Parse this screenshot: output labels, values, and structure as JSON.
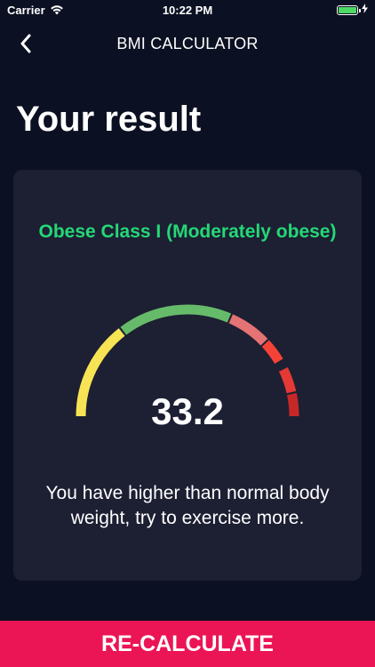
{
  "status_bar": {
    "carrier": "Carrier",
    "time": "10:22 PM",
    "icons": [
      "wifi-icon",
      "battery-icon",
      "charging-bolt-icon"
    ]
  },
  "nav": {
    "title": "BMI CALCULATOR",
    "back_icon": "chevron-left-icon"
  },
  "page_title": "Your result",
  "result": {
    "category": "Obese Class I (Moderately obese)",
    "category_color": "#24d876",
    "bmi": "33.2",
    "message": "You have higher than normal body weight, try to exercise more.",
    "gauge_segments": [
      {
        "name": "underweight",
        "color": "#f7e454"
      },
      {
        "name": "normal",
        "color": "#66bb6a"
      },
      {
        "name": "overweight",
        "color": "#e57373"
      },
      {
        "name": "obese-1",
        "color": "#f44336"
      },
      {
        "name": "obese-2",
        "color": "#e53935"
      },
      {
        "name": "obese-3",
        "color": "#c62828"
      }
    ]
  },
  "recalc_button": {
    "label": "RE-CALCULATE",
    "color": "#eb1555"
  },
  "colors": {
    "background": "#0b1022",
    "card": "#1d1f33"
  }
}
